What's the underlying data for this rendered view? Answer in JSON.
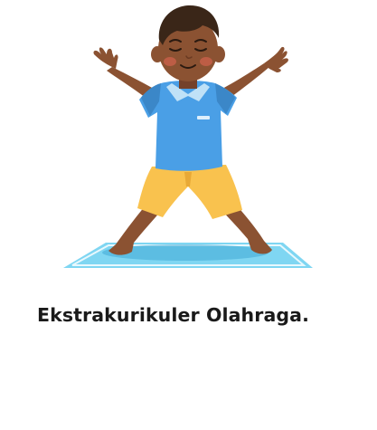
{
  "caption": "Ekstrakurikuler Olahraga.",
  "illustration": {
    "subject": "boy-star-pose-on-yoga-mat",
    "colors": {
      "skin": "#8B5232",
      "skin_shadow": "#74412A",
      "hair": "#3A2618",
      "cheek": "#C9604A",
      "shirt": "#4A9FE6",
      "shirt_shadow": "#3B87C8",
      "collar": "#BFE1F7",
      "pocket": "#DDEFFC",
      "shorts": "#F9C24E",
      "shorts_shadow": "#E8A936",
      "mat": "#7FD6F2",
      "mat_line": "#E8F8FD",
      "mat_shadow": "#3FA9D6"
    }
  }
}
